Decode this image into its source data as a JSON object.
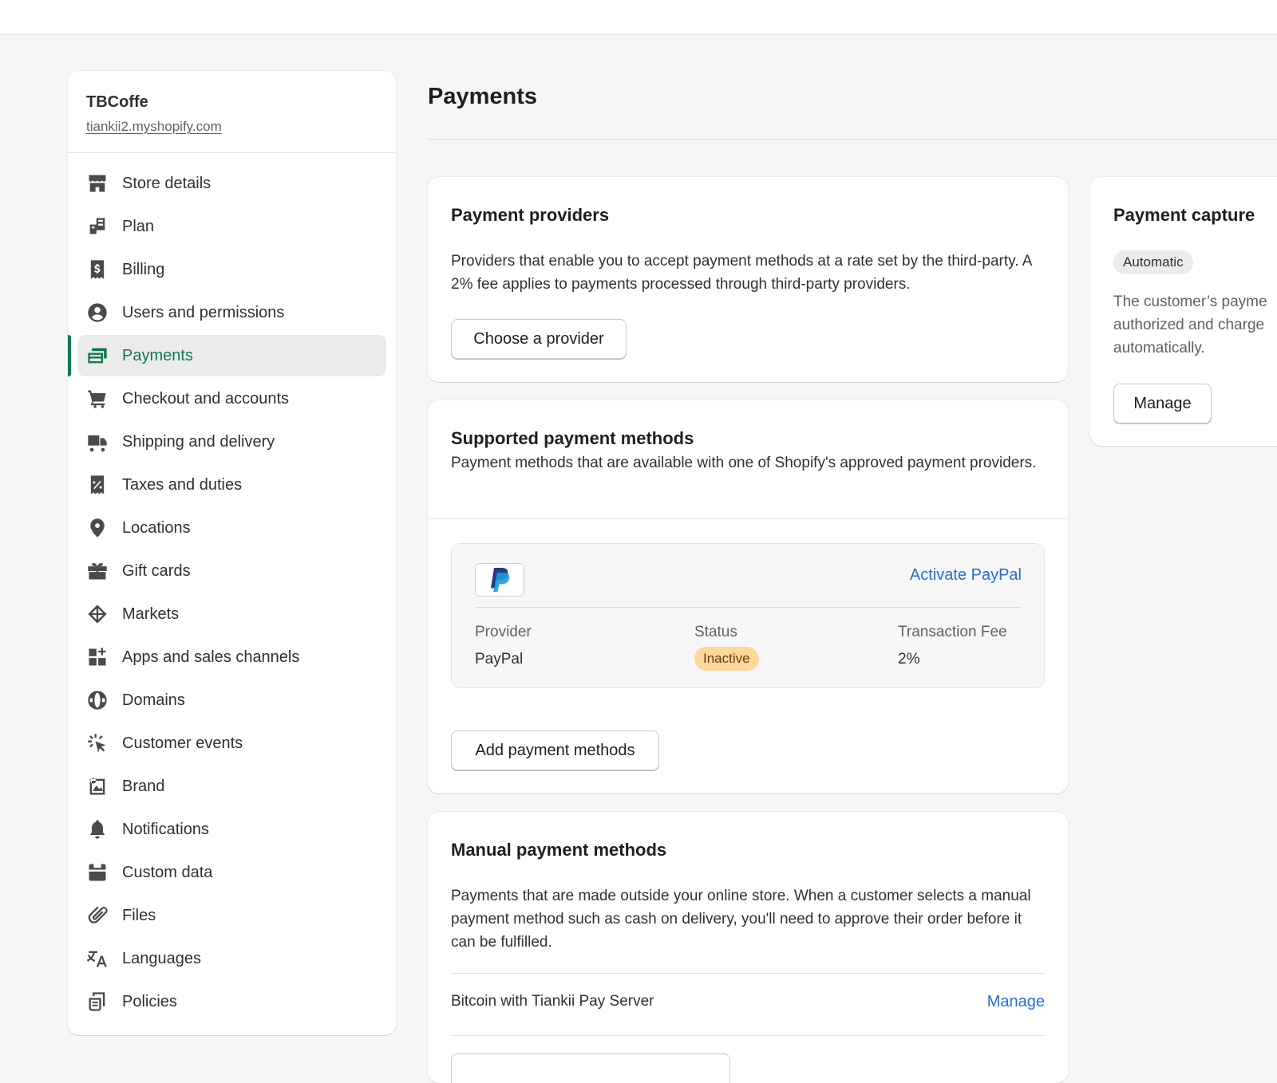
{
  "store": {
    "name": "TBCoffe",
    "url": "tiankii2.myshopify.com"
  },
  "sidebar": {
    "items": [
      {
        "label": "Store details",
        "icon": "store-icon"
      },
      {
        "label": "Plan",
        "icon": "plan-icon"
      },
      {
        "label": "Billing",
        "icon": "billing-icon"
      },
      {
        "label": "Users and permissions",
        "icon": "user-icon"
      },
      {
        "label": "Payments",
        "icon": "payments-icon",
        "active": true
      },
      {
        "label": "Checkout and accounts",
        "icon": "cart-icon"
      },
      {
        "label": "Shipping and delivery",
        "icon": "truck-icon"
      },
      {
        "label": "Taxes and duties",
        "icon": "tax-icon"
      },
      {
        "label": "Locations",
        "icon": "location-icon"
      },
      {
        "label": "Gift cards",
        "icon": "gift-icon"
      },
      {
        "label": "Markets",
        "icon": "markets-icon"
      },
      {
        "label": "Apps and sales channels",
        "icon": "apps-icon"
      },
      {
        "label": "Domains",
        "icon": "globe-icon"
      },
      {
        "label": "Customer events",
        "icon": "cursor-icon"
      },
      {
        "label": "Brand",
        "icon": "brand-icon"
      },
      {
        "label": "Notifications",
        "icon": "bell-icon"
      },
      {
        "label": "Custom data",
        "icon": "custom-data-icon"
      },
      {
        "label": "Files",
        "icon": "paperclip-icon"
      },
      {
        "label": "Languages",
        "icon": "translate-icon"
      },
      {
        "label": "Policies",
        "icon": "policy-icon"
      }
    ]
  },
  "page": {
    "title": "Payments"
  },
  "providers": {
    "title": "Payment providers",
    "description": "Providers that enable you to accept payment methods at a rate set by the third-party. A 2% fee applies to payments processed through third-party providers.",
    "button": "Choose a provider"
  },
  "supported": {
    "title": "Supported payment methods",
    "description": "Payment methods that are available with one of Shopify's approved payment providers.",
    "paypal": {
      "activate_link": "Activate PayPal",
      "provider_header": "Provider",
      "status_header": "Status",
      "fee_header": "Transaction Fee",
      "provider_value": "PayPal",
      "status_value": "Inactive",
      "fee_value": "2%"
    },
    "button": "Add payment methods"
  },
  "manual": {
    "title": "Manual payment methods",
    "description": "Payments that are made outside your online store. When a customer selects a manual payment method such as cash on delivery, you'll need to approve their order before it can be fulfilled.",
    "row_label": "Bitcoin with Tiankii Pay Server",
    "row_link": "Manage"
  },
  "capture": {
    "title": "Payment capture",
    "badge": "Automatic",
    "description": "The customer’s payme authorized and charge automatically.",
    "button": "Manage"
  },
  "colors": {
    "accent_green": "#0f7a4a",
    "link_blue": "#2a6bd8",
    "inactive_badge": "#ffd79d"
  }
}
